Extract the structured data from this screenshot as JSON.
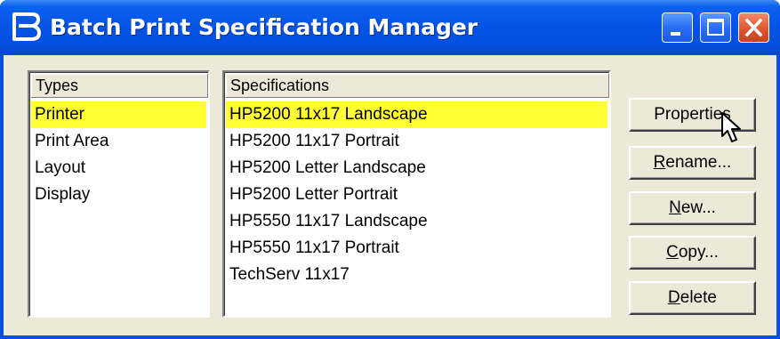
{
  "window": {
    "title": "Batch Print Specification Manager",
    "app_icon": "bentley-b-icon",
    "controls": [
      "minimize-icon",
      "maximize-icon",
      "close-icon"
    ]
  },
  "types": {
    "header": "Types",
    "items": [
      "Printer",
      "Print Area",
      "Layout",
      "Display"
    ],
    "selected_index": 0
  },
  "specifications": {
    "header": "Specifications",
    "items": [
      "HP5200 11x17 Landscape",
      "HP5200 11x17 Portrait",
      "HP5200 Letter Landscape",
      "HP5200 Letter Portrait",
      "HP5550 11x17 Landscape",
      "HP5550 11x17 Portrait",
      "TechServ 11x17"
    ],
    "selected_index": 0
  },
  "buttons": {
    "properties": "Properties",
    "rename": {
      "mnemonic": "R",
      "rest": "ename..."
    },
    "new": {
      "mnemonic": "N",
      "rest": "ew..."
    },
    "copy": {
      "mnemonic": "C",
      "rest": "opy..."
    },
    "delete": {
      "mnemonic": "D",
      "rest": "elete"
    }
  },
  "colors": {
    "selection": "#ffff33",
    "titlebar": "#0453e4",
    "dialog_face": "#ece9d8"
  },
  "cursor": "arrow-pointer-icon"
}
